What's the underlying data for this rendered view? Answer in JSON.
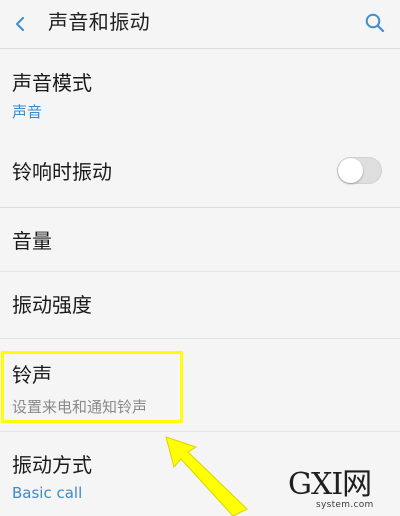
{
  "header": {
    "title": "声音和振动",
    "back_icon": "back-chevron-icon",
    "search_icon": "search-icon"
  },
  "settings": {
    "sound_mode": {
      "label": "声音模式",
      "value": "声音"
    },
    "vibrate_on_ring": {
      "label": "铃响时振动",
      "enabled": false
    },
    "volume": {
      "label": "音量"
    },
    "vibration_intensity": {
      "label": "振动强度"
    },
    "ringtone": {
      "label": "铃声",
      "description": "设置来电和通知铃声"
    },
    "vibration_pattern": {
      "label": "振动方式",
      "value": "Basic call"
    }
  },
  "annotation": {
    "highlight_color": "#ffff00",
    "arrow_color": "#ffff00"
  },
  "watermark": {
    "main_text": "GXI网",
    "sub_text": "system.com"
  },
  "colors": {
    "accent": "#3a8ad0",
    "background": "#f5f5f5",
    "divider": "#dddddd"
  }
}
